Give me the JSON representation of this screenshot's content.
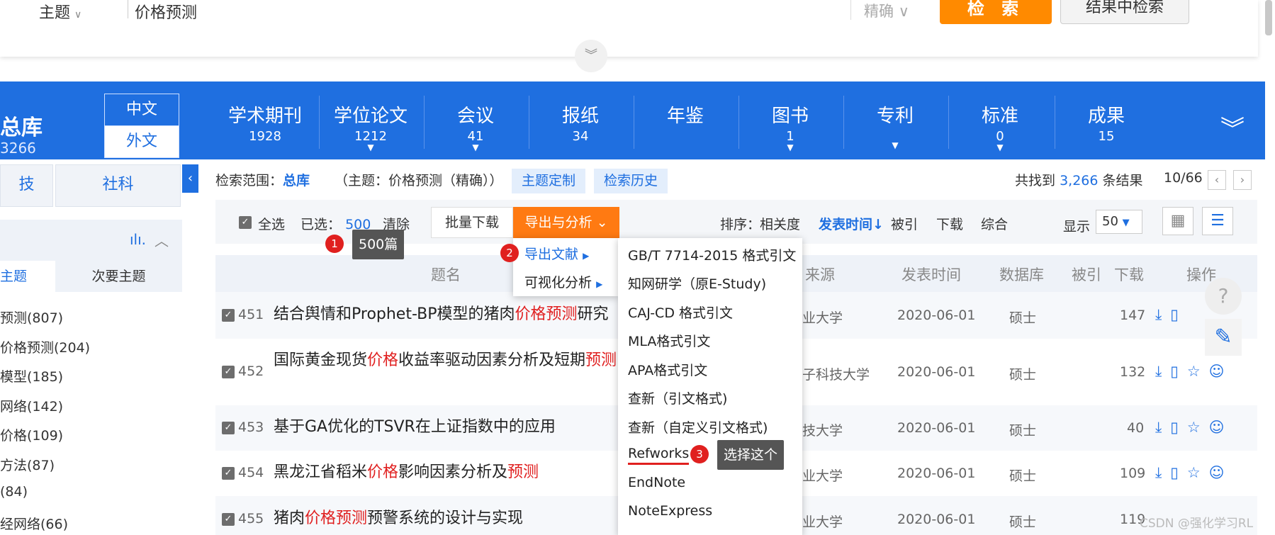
{
  "search": {
    "scope": "主题",
    "query": "价格预测",
    "precision": "精确",
    "search_button": "检 索",
    "result_search_button": "结果中检索"
  },
  "nav": {
    "total_label": "总库",
    "total_count": "3266",
    "lang_cn": "中文",
    "lang_foreign": "外文",
    "tabs": [
      {
        "label": "学术期刊",
        "count": "1928"
      },
      {
        "label": "学位论文",
        "count": "1212"
      },
      {
        "label": "会议",
        "count": "41"
      },
      {
        "label": "报纸",
        "count": "34"
      },
      {
        "label": "年鉴",
        "count": ""
      },
      {
        "label": "图书",
        "count": "1"
      },
      {
        "label": "专利",
        "count": ""
      },
      {
        "label": "标准",
        "count": "0"
      },
      {
        "label": "成果",
        "count": "15"
      }
    ]
  },
  "left": {
    "cat1": "技",
    "cat2": "社科",
    "tab_main": "主题",
    "tab_secondary": "次要主题",
    "items": [
      "预测(807)",
      "价格预测(204)",
      "模型(185)",
      "网络(142)",
      "价格(109)",
      "方法(87)",
      "(84)",
      "经网络(66)"
    ]
  },
  "info": {
    "scope_label": "检索范围：",
    "scope_value": "总库",
    "query_desc": "（主题：价格预测（精确））",
    "custom_btn": "主题定制",
    "history_btn": "检索历史",
    "found_prefix": "共找到",
    "found_count": "3,266",
    "found_suffix": "条结果",
    "page": "10/66",
    "prev": "‹",
    "next": "›"
  },
  "toolbar": {
    "select_all": "全选",
    "selected_label": "已选：",
    "selected_count": "500",
    "clear": "清除",
    "batch_download": "批量下载",
    "export": "导出与分析",
    "sort_label": "排序：",
    "sort_relevance": "相关度",
    "sort_date": "发表时间",
    "sort_cited": "被引",
    "sort_download": "下载",
    "sort_overall": "综合",
    "display_label": "显示",
    "display_value": "50"
  },
  "table": {
    "headers": [
      "题名",
      "来源",
      "发表时间",
      "数据库",
      "被引",
      "下载",
      "操作"
    ],
    "rows": [
      {
        "num": "451",
        "title_parts": [
          "结合舆情和Prophet-BP模型的猪肉",
          "价格预测",
          "研究"
        ],
        "source": "业大学",
        "date": "2020-06-01",
        "db": "硕士",
        "cited": "",
        "downloads": "147"
      },
      {
        "num": "452",
        "title_parts": [
          "国际黄金现货",
          "价格",
          "收益率驱动因素分析及短期",
          "预测",
          ""
        ],
        "source": "子科技大学",
        "date": "2020-06-01",
        "db": "硕士",
        "cited": "",
        "downloads": "132"
      },
      {
        "num": "453",
        "title_parts": [
          "基于GA优化的TSVR在上证指数中的应用"
        ],
        "source": "技大学",
        "date": "2020-06-01",
        "db": "硕士",
        "cited": "",
        "downloads": "40"
      },
      {
        "num": "454",
        "title_parts": [
          "黑龙江省稻米",
          "价格",
          "影响因素分析及",
          "预测"
        ],
        "source": "业大学",
        "date": "2020-06-01",
        "db": "硕士",
        "cited": "",
        "downloads": "109"
      },
      {
        "num": "455",
        "title_parts": [
          "猪肉",
          "价格预测",
          "预警系统的设计与实现"
        ],
        "source": "业大学",
        "date": "2020-06-01",
        "db": "硕士",
        "cited": "",
        "downloads": "119"
      }
    ]
  },
  "menu1": {
    "export_docs": "导出文献",
    "visual_analysis": "可视化分析"
  },
  "menu2": {
    "items": [
      "GB/T 7714-2015 格式引文",
      "知网研学（原E-Study)",
      "CAJ-CD 格式引文",
      "MLA格式引文",
      "APA格式引文",
      "查新（引文格式)",
      "查新（自定义引文格式)",
      "Refworks",
      "EndNote",
      "NoteExpress"
    ]
  },
  "annotations": {
    "b1": "1",
    "t1": "500篇",
    "b2": "2",
    "b3": "3",
    "t3": "选择这个"
  },
  "watermark": "CSDN @强化学习RL"
}
